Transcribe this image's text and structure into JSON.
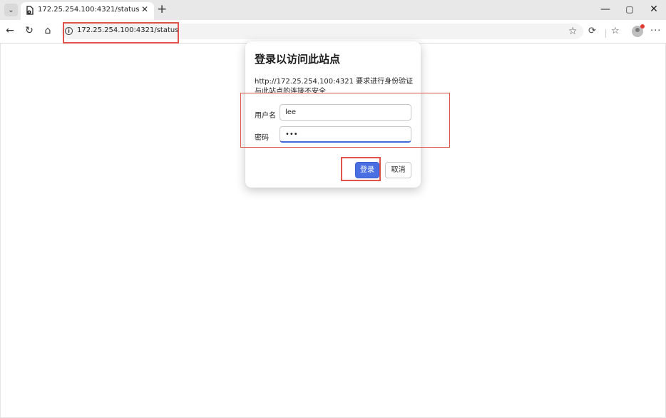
{
  "browser": {
    "tab": {
      "title": "172.25.254.100:4321/status",
      "close_glyph": "✕"
    },
    "tab_menu_glyph": "⌄",
    "new_tab_glyph": "+",
    "window_controls": {
      "minimize": "—",
      "maximize": "▢",
      "close": "✕"
    },
    "nav": {
      "back": "←",
      "reload": "↻",
      "home": "⌂"
    },
    "address": {
      "info_glyph": "i",
      "url": "172.25.254.100:4321/status"
    },
    "toolbar_icons": {
      "favorite": "☆",
      "copilot": "⟳",
      "favorites": "☆",
      "more": "···"
    }
  },
  "dialog": {
    "title": "登录以访问此站点",
    "message_line1": "http://172.25.254.100:4321 要求进行身份验证",
    "message_line2": "与此站点的连接不安全",
    "username_label": "用户名",
    "username_value": "lee",
    "password_label": "密码",
    "password_value": "•••",
    "login_button": "登录",
    "cancel_button": "取消"
  },
  "colors": {
    "accent": "#4a6fe3",
    "annotation": "#e0534a",
    "tabbar": "#e8e8e8"
  }
}
